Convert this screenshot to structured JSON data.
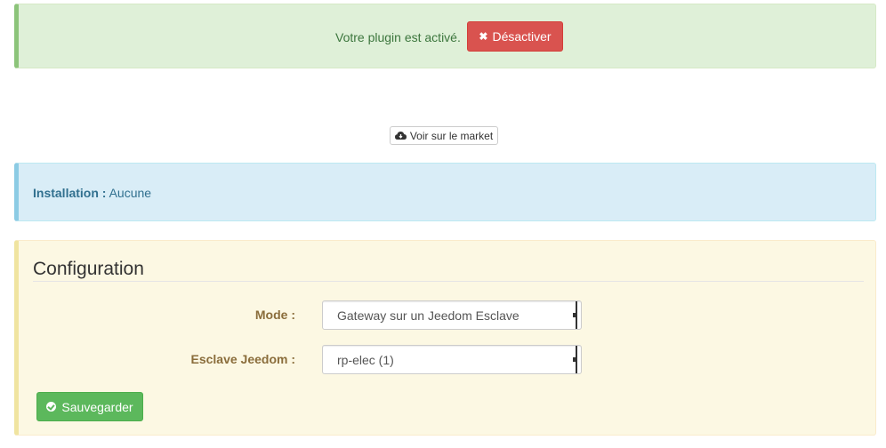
{
  "plugin_status": {
    "message": "Votre plugin est activé.",
    "deactivate_label": "Désactiver"
  },
  "market": {
    "label": "Voir sur le market"
  },
  "installation": {
    "label": "Installation :",
    "value": "Aucune"
  },
  "configuration": {
    "title": "Configuration",
    "mode_label": "Mode :",
    "mode_value": "Gateway sur un Jeedom Esclave",
    "slave_label": "Esclave Jeedom :",
    "slave_value": "rp-elec (1)",
    "save_label": "Sauvegarder"
  },
  "colors": {
    "success_bg": "#dff0d8",
    "danger": "#d9534f",
    "info_bg": "#d9edf7",
    "warning_bg": "#fcf8e3",
    "save": "#5cb85c"
  }
}
